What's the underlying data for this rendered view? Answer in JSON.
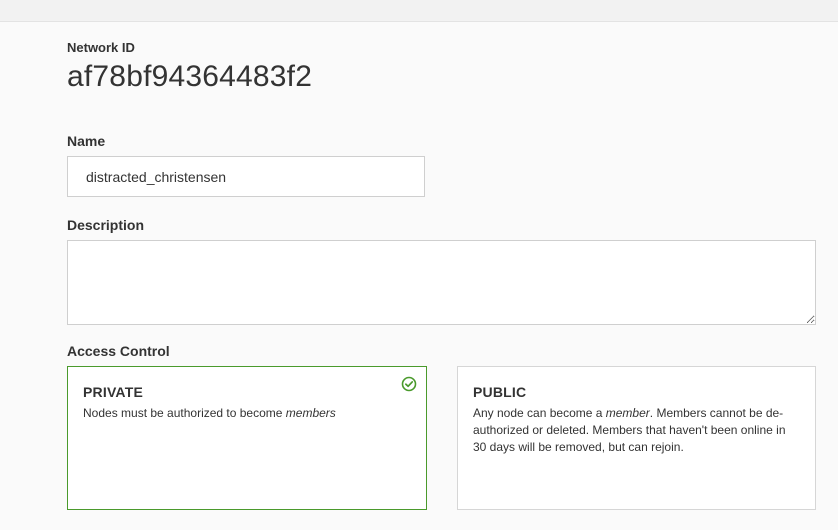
{
  "network": {
    "id_label": "Network ID",
    "id_value": "af78bf94364483f2"
  },
  "name": {
    "label": "Name",
    "value": "distracted_christensen"
  },
  "description": {
    "label": "Description",
    "value": ""
  },
  "access_control": {
    "label": "Access Control",
    "private": {
      "title": "PRIVATE",
      "desc_prefix": "Nodes must be authorized to become ",
      "desc_emphasis": "members",
      "selected": true
    },
    "public": {
      "title": "PUBLIC",
      "desc_prefix": "Any node can become a ",
      "desc_emphasis": "member",
      "desc_suffix": ". Members cannot be de-authorized or deleted. Members that haven't been online in 30 days will be removed, but can rejoin.",
      "selected": false
    }
  },
  "colors": {
    "selected_border": "#4a9a2c",
    "check": "#4a9a2c"
  },
  "icons": {
    "selected_indicator": "check-circle-icon"
  }
}
